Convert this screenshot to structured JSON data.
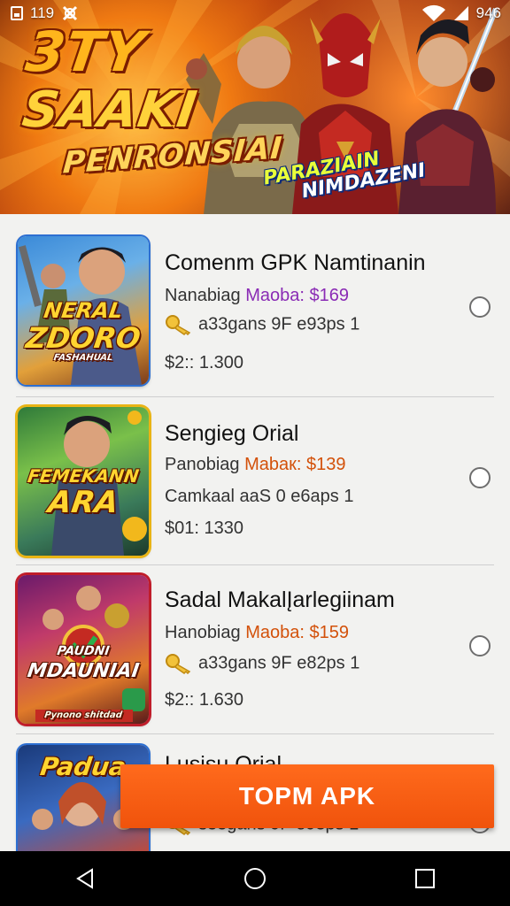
{
  "status_bar": {
    "time": "119",
    "battery": "946"
  },
  "banner": {
    "title_line1": "3TY",
    "title_line2": "SAAKI",
    "title_line3": "PENRONSIAI",
    "subtitle_line1": "PARAZIAIN",
    "subtitle_line2": "NIMDAZENI"
  },
  "apps": [
    {
      "title": "Comenm GPK Namtinanin",
      "line1_prefix": "Nanabiag ",
      "line1_price": "Maoba: $169",
      "line1_color": "#8a2bb5",
      "line2": "a33gans 9F e93ps 1",
      "line2_has_key": true,
      "line3": "$2:: 1.300",
      "thumb_text1": "NERAL",
      "thumb_text2": "ZDORO",
      "thumb_text3": "FASHAHUAL"
    },
    {
      "title": "Sengieg Orial",
      "line1_prefix": "Panobiag ",
      "line1_price": "Mabaк: $139",
      "line1_color": "#d3510a",
      "line2": "Camkaal aaS 0  e6aps 1",
      "line2_has_key": false,
      "line3": "$01: 1330",
      "thumb_text1": "FEMEKANN",
      "thumb_text2": "ARA"
    },
    {
      "title": "Sadal MakalĮarlegiinam",
      "line1_prefix": "Hanobiag ",
      "line1_price": "Maoba: $159",
      "line1_color": "#d3510a",
      "line2": "a33gans 9F e82ps 1",
      "line2_has_key": true,
      "line3": "$2:: 1.630",
      "thumb_text1": "PAUDNI",
      "thumb_text2": "MDAUNIAI",
      "thumb_text3": "Pynono shitdad"
    },
    {
      "title": "Lusisu Orial",
      "line2": "s33gans 9F e93ps 1",
      "thumb_text1": "Padua"
    }
  ],
  "cta": {
    "label": "TOPM APK"
  },
  "colors": {
    "accent": "#f0530c",
    "divider": "#cfcfcf"
  },
  "icons": [
    "sim-icon",
    "notification-icon",
    "wifi-icon",
    "signal-icon",
    "key-icon",
    "back-icon",
    "home-icon",
    "recents-icon"
  ]
}
